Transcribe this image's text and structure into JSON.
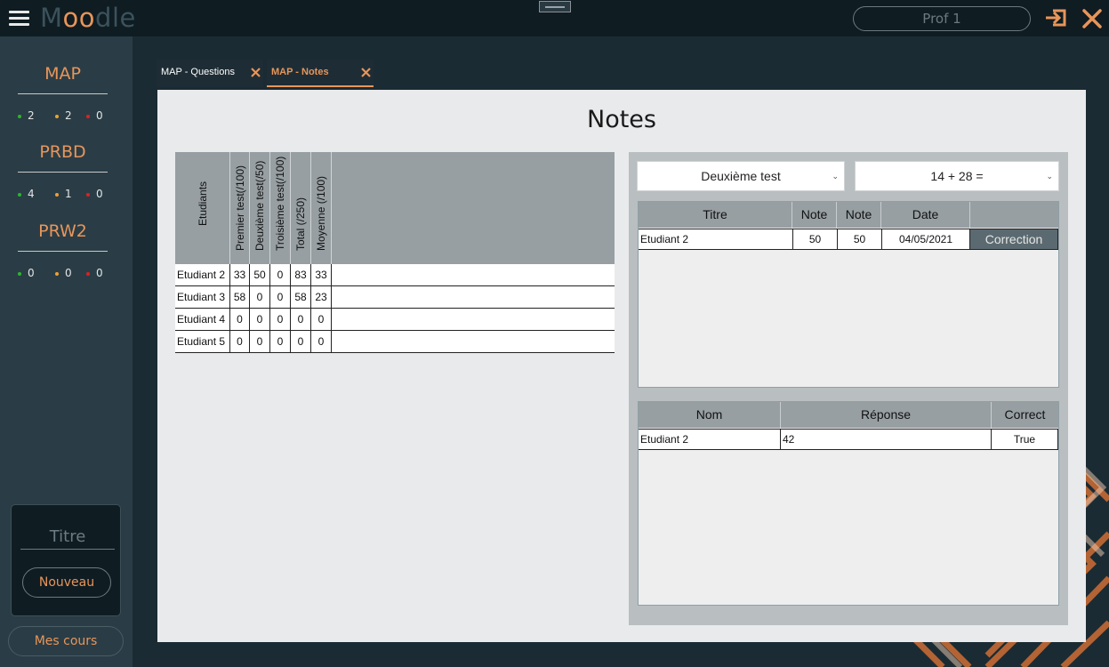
{
  "app": {
    "logo_m": "M",
    "logo_oo": "oo",
    "logo_dle": "dle",
    "user": "Prof 1"
  },
  "colors": {
    "accent": "#e8955a",
    "sidebar": "#2a3d46",
    "topbar": "#0f1c22",
    "stat_green": "#2db52d",
    "stat_orange": "#f0a030",
    "stat_red": "#e02020"
  },
  "icons": {
    "menu": "hamburger-icon",
    "logout": "logout-icon",
    "close": "close-icon",
    "tab_close": "close-icon",
    "select": "chevron-down-icon"
  },
  "sidebar": {
    "courses": [
      {
        "title": "MAP",
        "green": "2",
        "orange": "2",
        "red": "0"
      },
      {
        "title": "PRBD",
        "green": "4",
        "orange": "1",
        "red": "0"
      },
      {
        "title": "PRW2",
        "green": "0",
        "orange": "0",
        "red": "0"
      }
    ],
    "new_box_title": "Titre",
    "new_button": "Nouveau",
    "my_courses_button": "Mes cours"
  },
  "tabs": [
    {
      "label": "MAP - Questions",
      "active": false
    },
    {
      "label": "MAP - Notes",
      "active": true
    }
  ],
  "main": {
    "title": "Notes"
  },
  "grades": {
    "headers": [
      "Etudiants",
      "Premier test(/100)",
      "Deuxième test(/50)",
      "Troisième test(/100)",
      "Total (/250)",
      "Moyenne (/100)"
    ],
    "rows": [
      [
        "Etudiant 2",
        "33",
        "50",
        "0",
        "83",
        "33"
      ],
      [
        "Etudiant 3",
        "58",
        "0",
        "0",
        "58",
        "23"
      ],
      [
        "Etudiant 4",
        "0",
        "0",
        "0",
        "0",
        "0"
      ],
      [
        "Etudiant 5",
        "0",
        "0",
        "0",
        "0",
        "0"
      ]
    ]
  },
  "right": {
    "test_select": "Deuxième test",
    "question_select": "14 + 28 =",
    "attempts": {
      "headers": [
        "Titre",
        "Note",
        "Note",
        "Date",
        ""
      ],
      "rows": [
        [
          "Etudiant 2",
          "50",
          "50",
          "04/05/2021",
          "Correction"
        ]
      ]
    },
    "answers": {
      "headers": [
        "Nom",
        "Réponse",
        "Correct"
      ],
      "rows": [
        [
          "Etudiant 2",
          "42",
          "True"
        ]
      ]
    }
  }
}
